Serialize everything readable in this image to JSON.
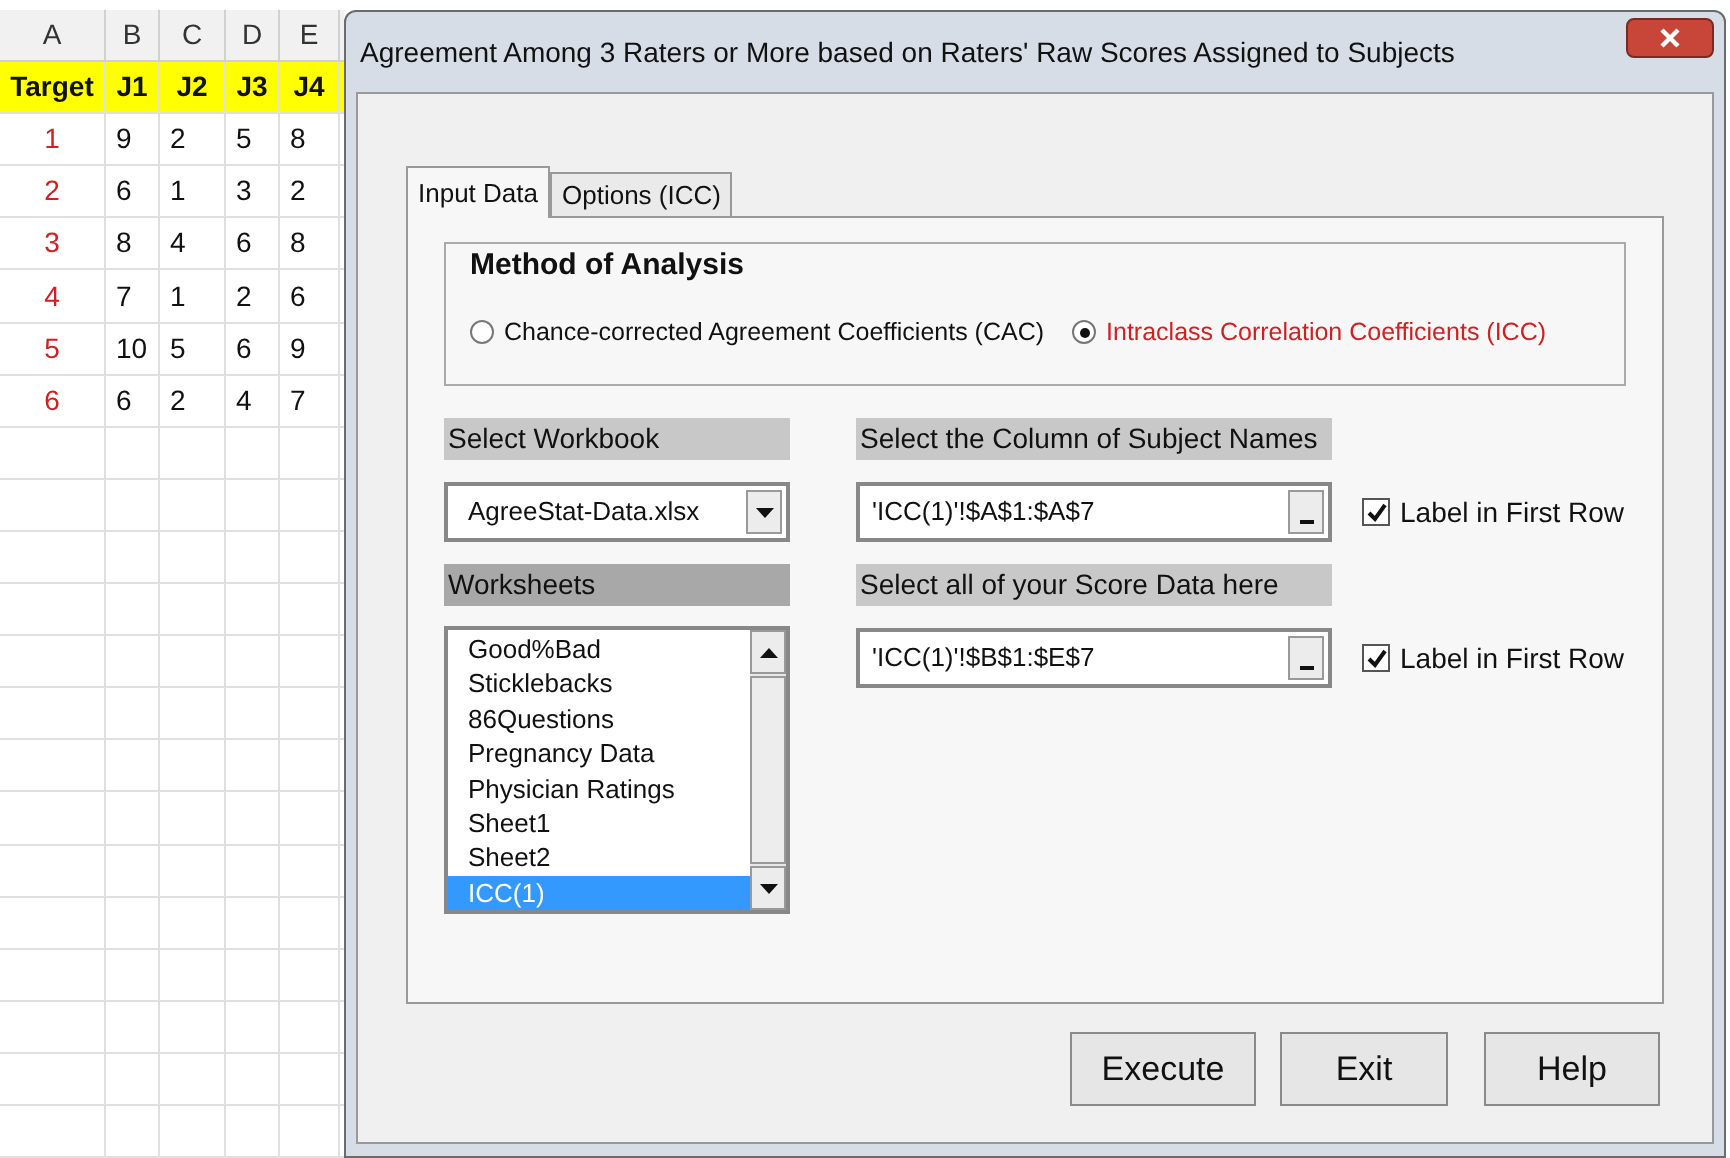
{
  "spreadsheet": {
    "columns": [
      "A",
      "B",
      "C",
      "D",
      "E"
    ],
    "rows": [
      [
        "Target",
        "J1",
        "J2",
        "J3",
        "J4"
      ],
      [
        "1",
        "9",
        "2",
        "5",
        "8"
      ],
      [
        "2",
        "6",
        "1",
        "3",
        "2"
      ],
      [
        "3",
        "8",
        "4",
        "6",
        "8"
      ],
      [
        "4",
        "7",
        "1",
        "2",
        "6"
      ],
      [
        "5",
        "10",
        "5",
        "6",
        "9"
      ],
      [
        "6",
        "6",
        "2",
        "4",
        "7"
      ]
    ]
  },
  "dialog": {
    "title": "Agreement Among 3 Raters or More based on Raters' Raw Scores Assigned to Subjects",
    "tabs": [
      {
        "label": "Input Data",
        "selected": true
      },
      {
        "label": "Options (ICC)",
        "selected": false
      }
    ],
    "method": {
      "title": "Method of Analysis",
      "options": [
        {
          "label": "Chance-corrected Agreement Coefficients (CAC)",
          "selected": false
        },
        {
          "label": "Intraclass Correlation Coefficients (ICC)",
          "selected": true
        }
      ]
    },
    "workbook": {
      "label": "Select Workbook",
      "value": "AgreeStat-Data.xlsx"
    },
    "worksheets": {
      "label": "Worksheets",
      "items": [
        {
          "label": "Good%Bad",
          "selected": false
        },
        {
          "label": "Sticklebacks",
          "selected": false
        },
        {
          "label": "86Questions",
          "selected": false
        },
        {
          "label": "Pregnancy Data",
          "selected": false
        },
        {
          "label": "Physician Ratings",
          "selected": false
        },
        {
          "label": "Sheet1",
          "selected": false
        },
        {
          "label": "Sheet2",
          "selected": false
        },
        {
          "label": "ICC(1)",
          "selected": true
        }
      ]
    },
    "ranges": [
      {
        "label": "Select the Column of Subject Names",
        "value": "'ICC(1)'!$A$1:$A$7",
        "checkbox": {
          "label": "Label in First Row",
          "checked": true
        }
      },
      {
        "label": "Select all of your Score Data here",
        "value": "'ICC(1)'!$B$1:$E$7",
        "checkbox": {
          "label": "Label in First Row",
          "checked": true
        }
      }
    ],
    "buttons": [
      "Execute",
      "Exit",
      "Help"
    ]
  }
}
